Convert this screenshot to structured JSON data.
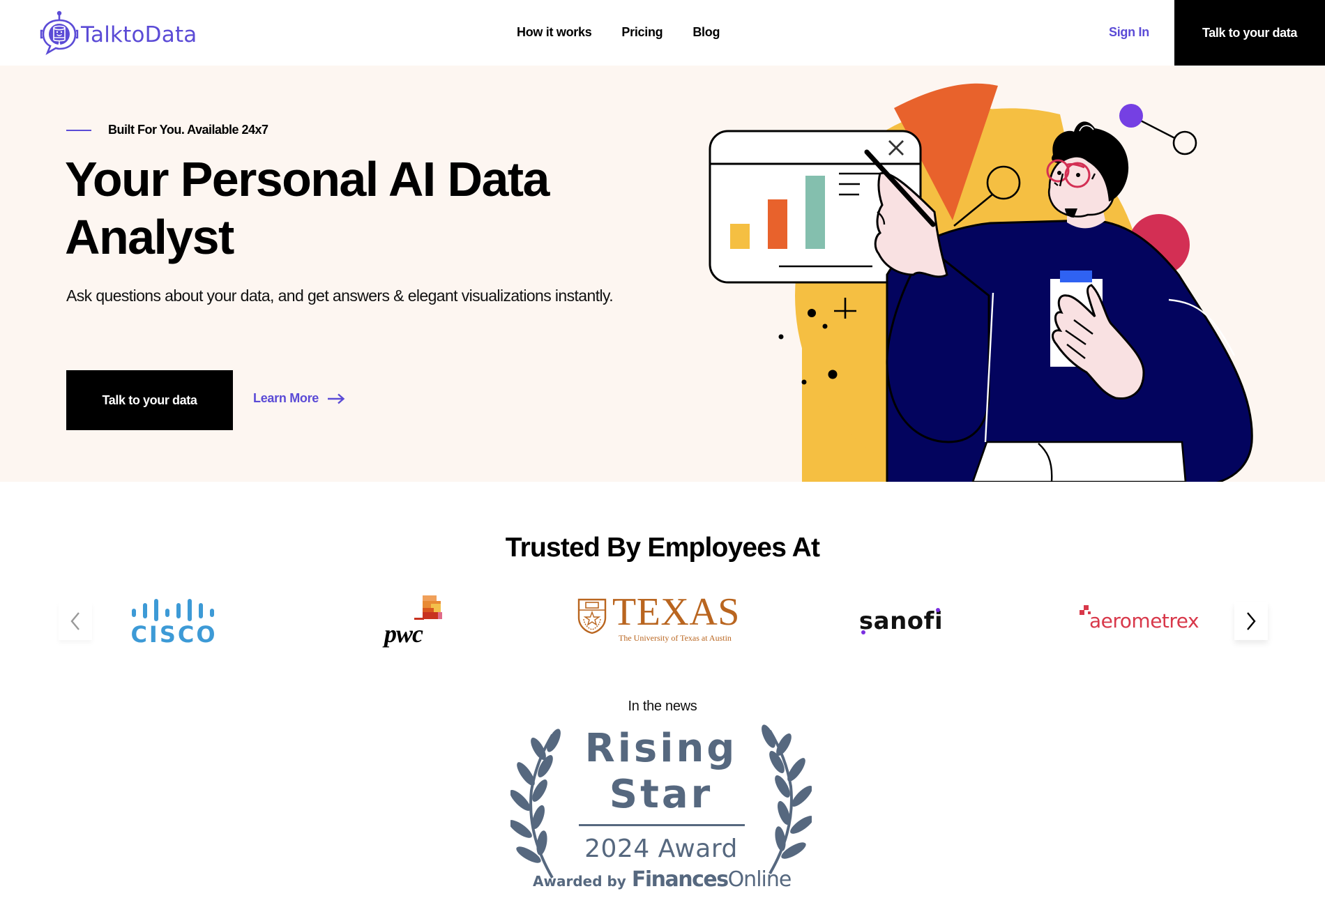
{
  "header": {
    "brand": "TalktoData",
    "nav": [
      {
        "label": "How it works"
      },
      {
        "label": "Pricing"
      },
      {
        "label": "Blog"
      }
    ],
    "sign_in": "Sign In",
    "cta": "Talk to your data"
  },
  "hero": {
    "tagline": "Built For You. Available 24x7",
    "headline_line1": "Your Personal AI Data",
    "headline_line2": "Analyst",
    "subtitle": "Ask questions about your data, and get answers & elegant visualizations instantly.",
    "primary_cta": "Talk to your data",
    "secondary_cta": "Learn More",
    "illustration": "person-presenting-bar-chart-illustration"
  },
  "trusted": {
    "title": "Trusted By Employees At",
    "logos": [
      {
        "name": "cisco",
        "text": "CISCO"
      },
      {
        "name": "pwc",
        "text": "pwc"
      },
      {
        "name": "texas",
        "text": "TEXAS",
        "subtext": "The University of Texas at Austin"
      },
      {
        "name": "sanofi",
        "text": "sanofi"
      },
      {
        "name": "aerometrex",
        "text": "aerometrex"
      }
    ],
    "prev_icon": "chevron-left-icon",
    "next_icon": "chevron-right-icon"
  },
  "news": {
    "label": "In the news",
    "award": {
      "line1": "Rising",
      "line2": "Star",
      "year_award": "2024 Award",
      "awarded_by": "Awarded by",
      "org_bold": "Finances",
      "org_light": "Online"
    }
  },
  "colors": {
    "brand_purple": "#5b4bd6",
    "hero_bg": "#fdf6f1",
    "award_slate": "#56687f",
    "cisco_blue": "#3d9ad6",
    "texas_orange": "#b9651f",
    "aerometrex_red": "#d8384a"
  }
}
